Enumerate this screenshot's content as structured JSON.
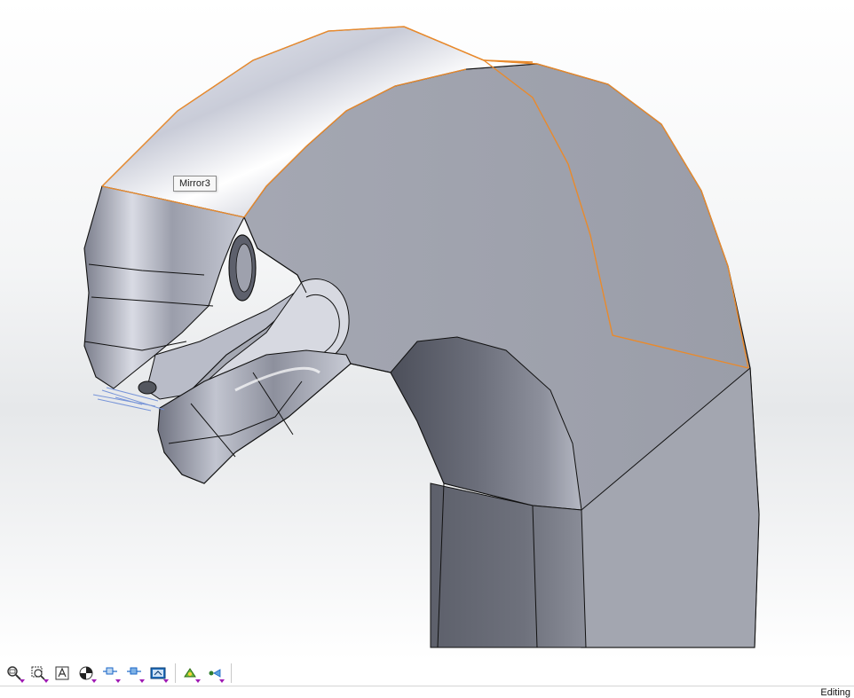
{
  "viewport": {
    "tooltip": "Mirror3",
    "colors": {
      "selection_edge": "#e98a2c",
      "model_face": "#9fa2ad",
      "edge_line": "#111111"
    }
  },
  "toolbar": {
    "buttons": [
      {
        "name": "zoom-to-fit-icon",
        "has_dropdown": true
      },
      {
        "name": "zoom-to-area-icon",
        "has_dropdown": true
      },
      {
        "name": "previous-view-icon",
        "has_dropdown": false
      },
      {
        "name": "section-view-icon",
        "has_dropdown": true
      },
      {
        "name": "view-orientation-icon",
        "has_dropdown": true
      },
      {
        "name": "display-style-icon",
        "has_dropdown": true
      },
      {
        "name": "hide-show-items-icon",
        "has_dropdown": true
      },
      {
        "name": "edit-appearance-icon",
        "has_dropdown": true
      },
      {
        "name": "apply-scene-icon",
        "has_dropdown": true
      }
    ]
  },
  "statusbar": {
    "mode": "Editing"
  }
}
